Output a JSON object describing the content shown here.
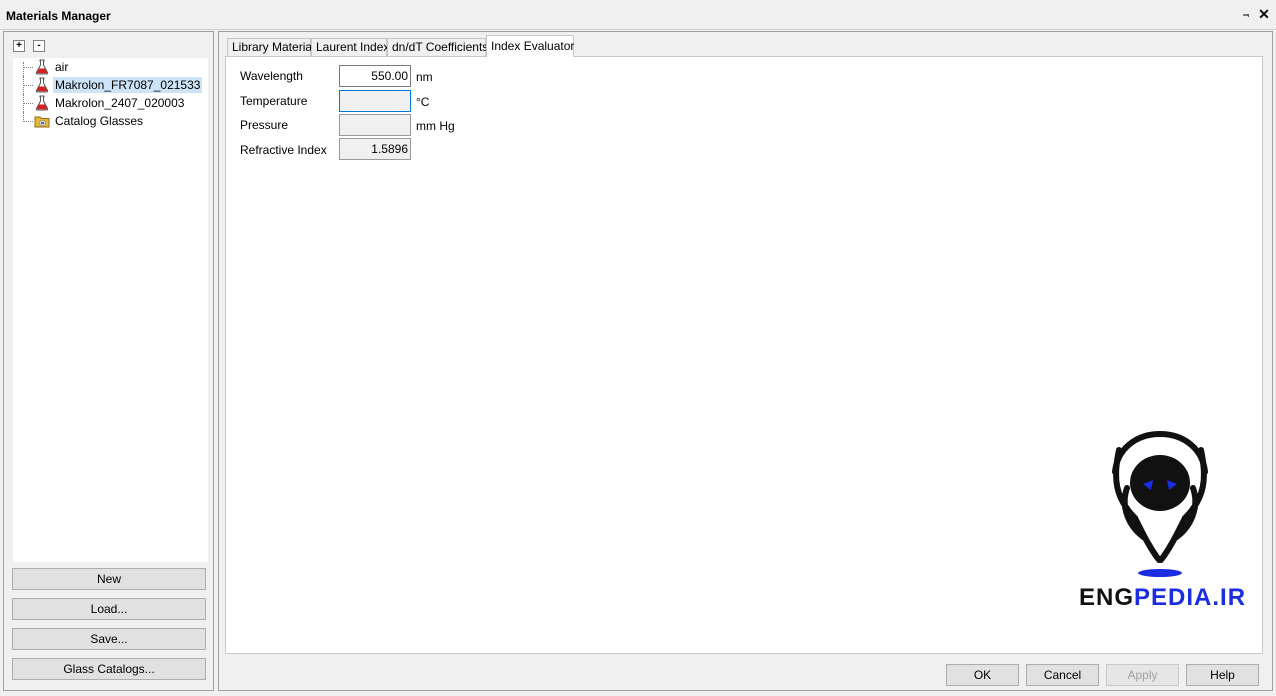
{
  "window": {
    "title": "Materials Manager",
    "pin_icon": "pin-icon",
    "close_icon": "close-icon"
  },
  "tree_tools": {
    "expand_label": "+",
    "collapse_label": "-"
  },
  "tree": {
    "items": [
      {
        "label": "air",
        "icon": "flask-icon",
        "selected": false
      },
      {
        "label": "Makrolon_FR7087_021533",
        "icon": "flask-icon",
        "selected": true
      },
      {
        "label": "Makrolon_2407_020003",
        "icon": "flask-icon",
        "selected": false
      },
      {
        "label": "Catalog Glasses",
        "icon": "folder-icon",
        "selected": false
      }
    ]
  },
  "left_buttons": {
    "new": "New",
    "load": "Load...",
    "save": "Save...",
    "glass_catalogs": "Glass Catalogs..."
  },
  "tabs": [
    {
      "label": "Library Material",
      "active": false
    },
    {
      "label": "Laurent Index",
      "active": false
    },
    {
      "label": "dn/dT Coefficients",
      "active": false
    },
    {
      "label": "Index Evaluator",
      "active": true
    }
  ],
  "evaluator": {
    "wavelength_label": "Wavelength",
    "wavelength_value": "550.00",
    "wavelength_unit": "nm",
    "temperature_label": "Temperature",
    "temperature_value": "",
    "temperature_unit": "°C",
    "pressure_label": "Pressure",
    "pressure_value": "",
    "pressure_unit": "mm Hg",
    "refractive_label": "Refractive Index",
    "refractive_value": "1.5896"
  },
  "watermark": {
    "text_part1": "ENG",
    "text_part2": "PEDIA.IR",
    "accent_color": "#1b2de0"
  },
  "dialog_buttons": {
    "ok": "OK",
    "cancel": "Cancel",
    "apply": "Apply",
    "help": "Help"
  }
}
